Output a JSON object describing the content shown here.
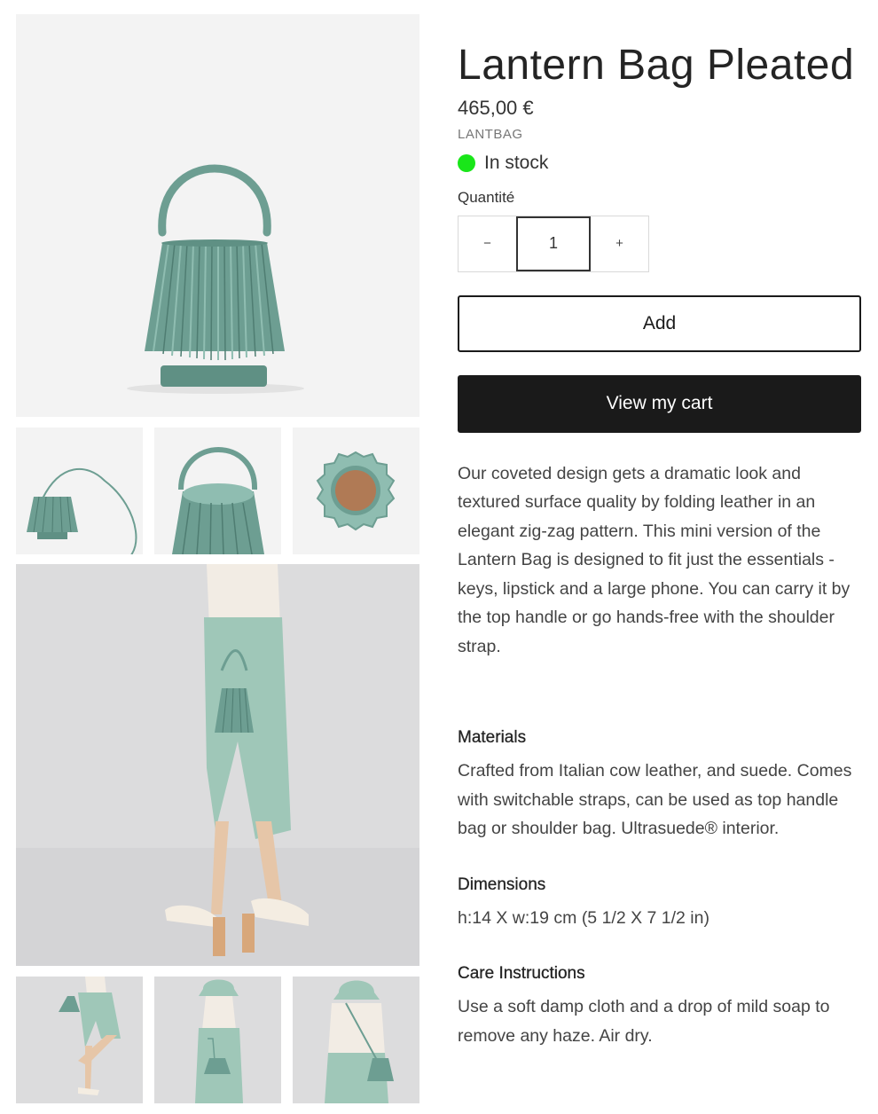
{
  "product": {
    "title": "Lantern Bag Pleated",
    "price": "465,00 €",
    "vendor": "LANTBAG",
    "stock_status": "In stock",
    "stock_color": "#19e619",
    "quantity_label": "Quantité",
    "quantity_value": "1",
    "minus_label": "−",
    "plus_label": "+",
    "add_label": "Add",
    "view_cart_label": "View my cart",
    "description": "Our coveted design gets a dramatic look and textured surface quality by folding leather in an elegant zig-zag pattern. This mini version of the Lantern Bag is designed to fit just the essentials - keys, lipstick and a large phone. You can carry it by the top handle or go hands-free with the shoulder strap."
  },
  "sections": [
    {
      "heading": "Materials",
      "text": "Crafted from Italian cow leather, and suede. Comes with switchable straps, can be used as top handle bag or shoulder bag. Ultrasuede® interior."
    },
    {
      "heading": "Dimensions",
      "text": "h:14 X w:19 cm (5 1/2 X 7 1/2 in)"
    },
    {
      "heading": "Care Instructions",
      "text": "Use a soft damp cloth and a drop of mild soap to remove any haze. Air dry."
    }
  ],
  "colors": {
    "bag": "#6d9e92",
    "button_dark": "#1a1a1a",
    "image_bg": "#f2f2f2"
  }
}
